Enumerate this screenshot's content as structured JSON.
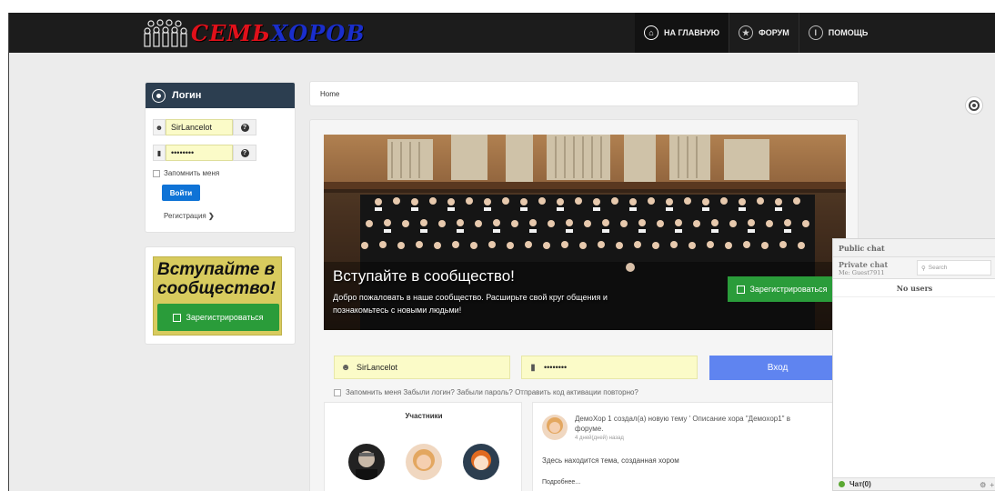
{
  "header": {
    "logo_text_red": "СЕМЬ",
    "logo_text_blue": "ХОРОВ",
    "nav": [
      {
        "label": "НА ГЛАВНУЮ",
        "icon": "home-icon"
      },
      {
        "label": "ФОРУМ",
        "icon": "star-icon"
      },
      {
        "label": "ПОМОЩЬ",
        "icon": "help-icon"
      }
    ]
  },
  "login_panel": {
    "title": "Логин",
    "username": "SirLancelot",
    "password": "••••••••",
    "remember_label": "Запомнить меня",
    "submit_label": "Войти",
    "register_link": "Регистрация"
  },
  "join_panel": {
    "title": "Вступайте в сообщество!",
    "button_label": "Зарегистрироваться"
  },
  "breadcrumb": {
    "home": "Home"
  },
  "hero": {
    "title": "Вступайте в сообщество!",
    "text": "Добро пожаловать в наше сообщество. Расширьте свой круг общения и познакомьтесь с новыми людьми!",
    "button_label": "Зарегистрироваться"
  },
  "main_login": {
    "username": "SirLancelot",
    "password": "••••••••",
    "submit_label": "Вход",
    "links_text": "Запомнить меня Забыли логин? Забыли пароль? Отправить код активации повторно?"
  },
  "members": {
    "title": "Участники"
  },
  "feed": {
    "item_text": "ДемоХор 1 создал(а) новую тему ' Описание хора \"Демохор1\" в форуме.",
    "item_time": "4 дней(дней) назад",
    "body": "Здесь находится тема, созданная хором",
    "more": "Подробнее..."
  },
  "chat": {
    "public_tab": "Public chat",
    "private_tab": "Private chat",
    "me_label": "Me: Guest7911",
    "search_placeholder": "Search",
    "no_users": "No users",
    "footer_label": "Чат(0)"
  },
  "colors": {
    "topbar": "#1c1c1c",
    "login_header": "#2c3e50",
    "primary_blue": "#0f73d6",
    "green": "#2a9c3a",
    "input_yellow": "#fbfbc8",
    "login_button": "#5f84f0"
  }
}
